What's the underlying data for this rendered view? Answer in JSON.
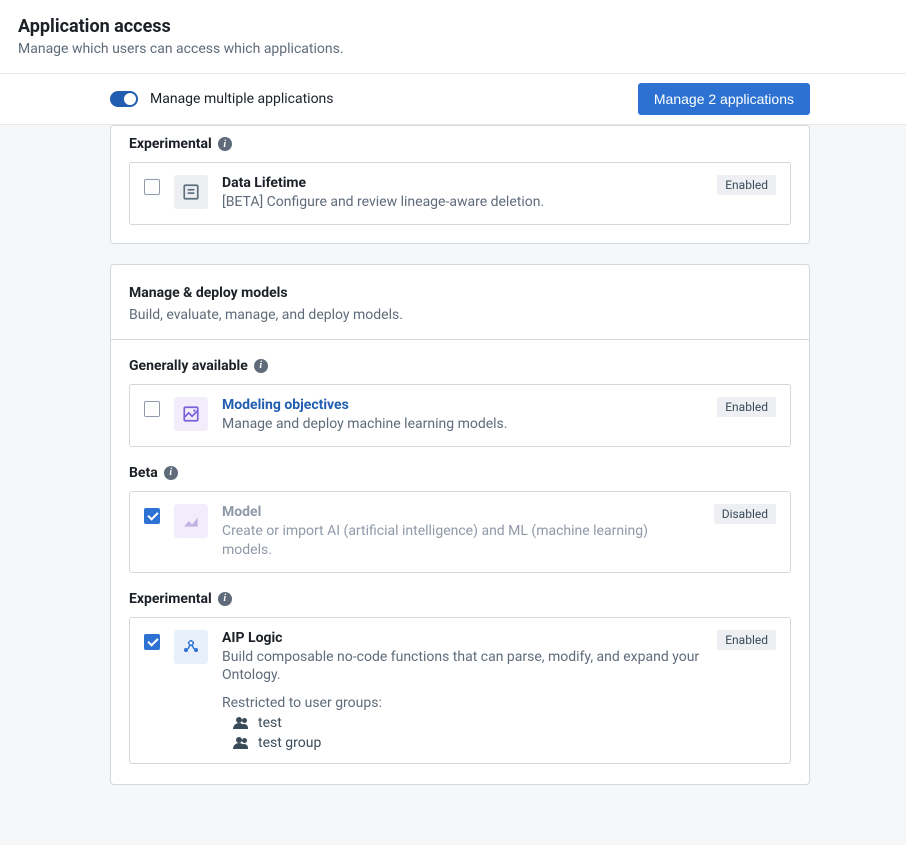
{
  "header": {
    "title": "Application access",
    "subtitle": "Manage which users can access which applications."
  },
  "toolbar": {
    "toggle_label": "Manage multiple applications",
    "manage_button": "Manage 2 applications"
  },
  "sections": {
    "first": {
      "group_label": "Experimental",
      "item": {
        "title": "Data Lifetime",
        "desc": "[BETA] Configure and review lineage-aware deletion.",
        "badge": "Enabled"
      }
    },
    "models": {
      "title": "Manage & deploy models",
      "desc": "Build, evaluate, manage, and deploy models.",
      "ga_label": "Generally available",
      "ga_item": {
        "title": "Modeling objectives",
        "desc": "Manage and deploy machine learning models.",
        "badge": "Enabled"
      },
      "beta_label": "Beta",
      "beta_item": {
        "title": "Model",
        "desc": "Create or import AI (artificial intelligence) and ML (machine learning) models.",
        "badge": "Disabled"
      },
      "exp_label": "Experimental",
      "exp_item": {
        "title": "AIP Logic",
        "desc": "Build composable no-code functions that can parse, modify, and expand your Ontology.",
        "badge": "Enabled",
        "restricted_label": "Restricted to user groups:",
        "groups": [
          "test",
          "test group"
        ]
      }
    }
  }
}
